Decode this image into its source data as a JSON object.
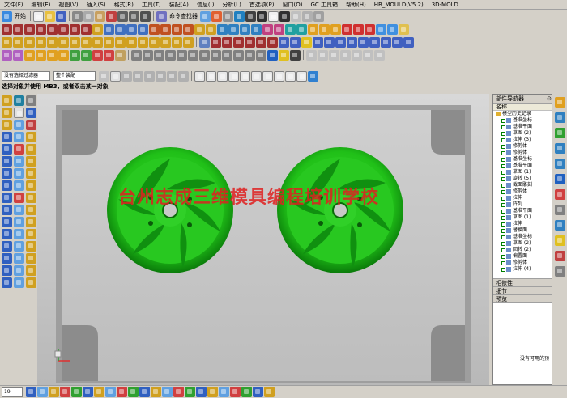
{
  "menu": [
    "文件(F)",
    "编辑(E)",
    "视图(V)",
    "插入(S)",
    "格式(R)",
    "工具(T)",
    "装配(A)",
    "信息(I)",
    "分析(L)",
    "首选项(P)",
    "窗口(O)",
    "GC 工具箱",
    "帮助(H)",
    "HB_MOULD(V5.2)",
    "3D-MOLD"
  ],
  "toolbar": {
    "start_label": "开始",
    "command_finder_label": "命令查找器"
  },
  "selection": {
    "filter_label": "没有选择过滤器",
    "scope_label": "整个装配"
  },
  "cue_line": "选择对象并使用 MB3，或者双击某一对象",
  "watermark": "台州志成三维模具编程培训学校",
  "navigator": {
    "title": "部件导航器",
    "column_header": "名称",
    "root": "模型历史记录",
    "items": [
      "基准坐标",
      "基准平面",
      "草图 (2)",
      "拉伸 (3)",
      "修剪体",
      "修剪体",
      "基准坐标",
      "基准平面",
      "草图 (1)",
      "旋转 (5)",
      "截面雕刻",
      "修剪体",
      "拉伸",
      "阵列",
      "基准平面",
      "草图 (1)",
      "拉伸",
      "替换面",
      "基准坐标",
      "草图 (2)",
      "回转 (2)",
      "偏置面",
      "修剪体",
      "拉伸 (4)"
    ],
    "sections": [
      "相依性",
      "细节",
      "预览"
    ],
    "preview_message": "没有可用的预"
  },
  "bottom": {
    "layer_value": "19"
  },
  "colors": {
    "model_green": "#22c51a",
    "viewport_bg": "#c8c8c8",
    "ui_bg": "#d4d0c8"
  }
}
